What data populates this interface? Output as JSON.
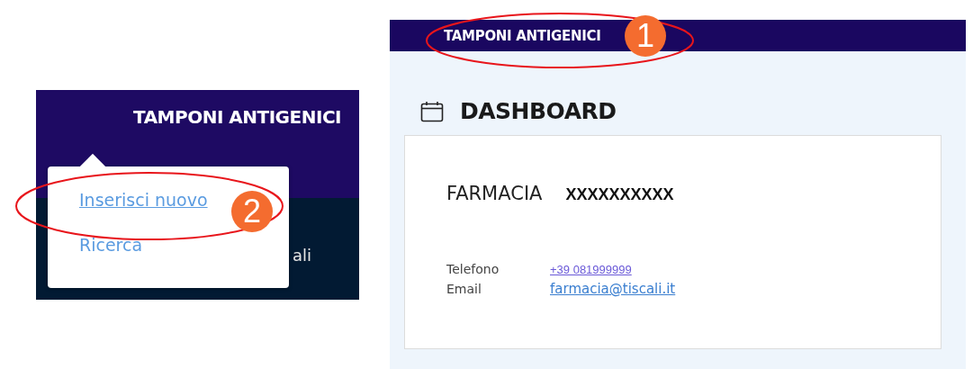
{
  "crop_panel": {
    "app_title": "TAMPONI ANTIGENICI",
    "menu_items": [
      {
        "label": "Inserisci nuovo"
      },
      {
        "label": "Ricerca"
      }
    ],
    "background_text": "ali"
  },
  "screen_panel": {
    "header_title": "TAMPONI ANTIGENICI",
    "page_title": "DASHBOARD",
    "card": {
      "label": "FARMACIA",
      "name": "XXXXXXXXXX",
      "fields": [
        {
          "label": "Telefono",
          "value": "+39 081999999"
        },
        {
          "label": "Email",
          "value": "farmacia@tiscali.it"
        }
      ]
    }
  },
  "callouts": [
    {
      "number": "1"
    },
    {
      "number": "2"
    }
  ]
}
